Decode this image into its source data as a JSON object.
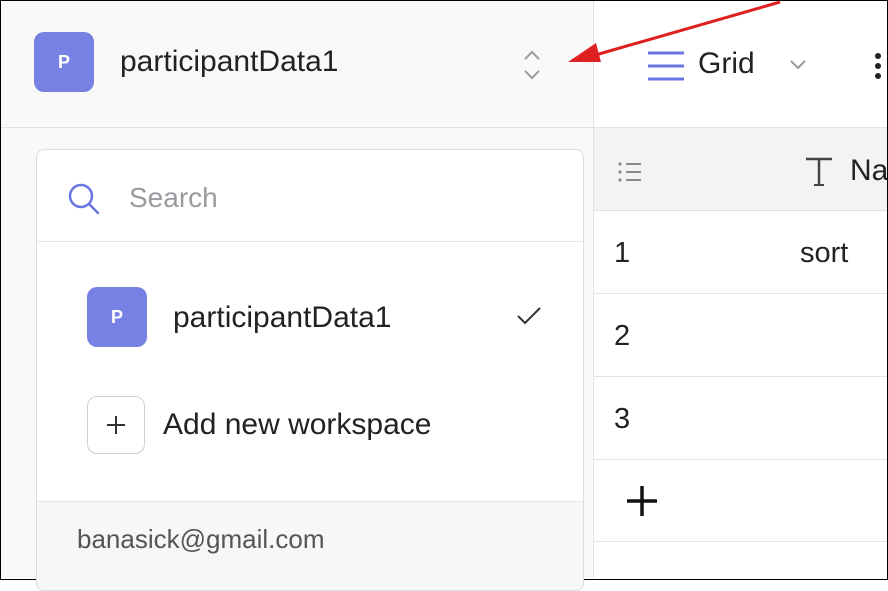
{
  "workspace": {
    "avatar_letter": "P",
    "name": "participantData1"
  },
  "dropdown": {
    "search_placeholder": "Search",
    "items": [
      {
        "avatar_letter": "P",
        "label": "participantData1",
        "selected": true
      }
    ],
    "add_label": "Add new workspace",
    "account_email": "banasick@gmail.com"
  },
  "toolbar": {
    "view_label": "Grid"
  },
  "table": {
    "column_name_partial": "Na",
    "rows": [
      {
        "num": "1",
        "name": "sort"
      },
      {
        "num": "2",
        "name": ""
      },
      {
        "num": "3",
        "name": ""
      }
    ]
  },
  "colors": {
    "avatar": "#7681e3",
    "annotation_arrow": "#e02020",
    "icon_accent": "#6b74e0"
  },
  "icons": [
    "chevron-up-down-icon",
    "search-icon",
    "checkmark-icon",
    "plus-icon",
    "grid-view-icon",
    "chevron-down-icon",
    "more-vertical-icon",
    "rows-list-icon",
    "text-type-icon"
  ]
}
